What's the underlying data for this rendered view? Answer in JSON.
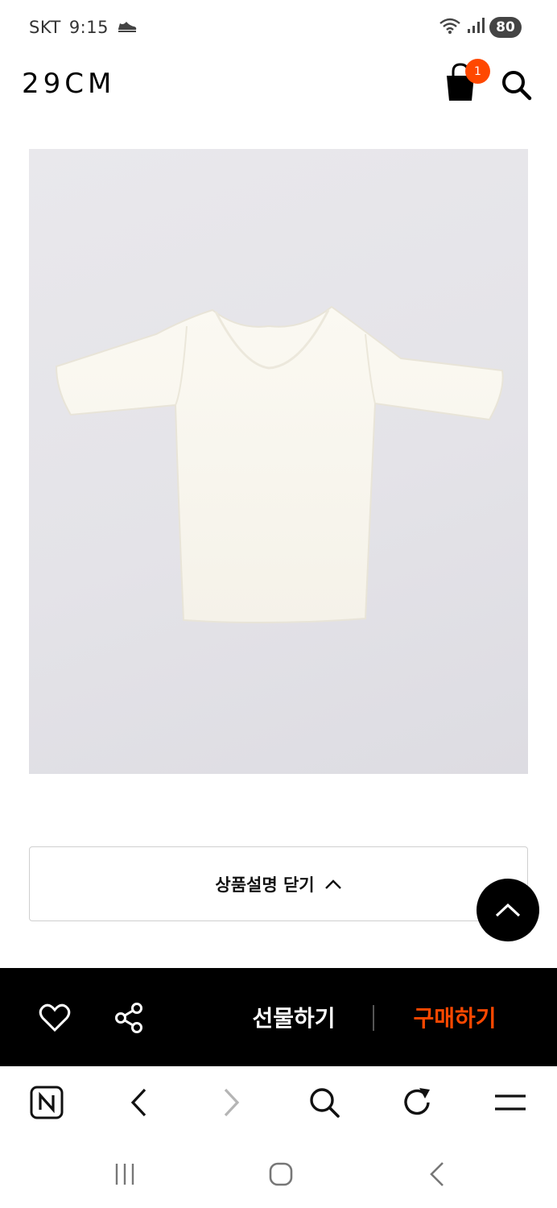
{
  "status_bar": {
    "carrier": "SKT",
    "time": "9:15",
    "battery": "80"
  },
  "header": {
    "logo": "29CM",
    "cart_count": "1"
  },
  "product": {
    "image_alt": "white lettuce-trim ribbed half-sleeve top"
  },
  "description_toggle": {
    "label": "상품설명 닫기"
  },
  "purchase_bar": {
    "gift_label": "선물하기",
    "buy_label": "구매하기",
    "buy_color": "#ff4800"
  },
  "browser_toolbar": {
    "items": [
      "naver-icon",
      "back-icon",
      "forward-icon",
      "search-icon",
      "refresh-icon",
      "menu-icon"
    ]
  },
  "android_nav": {
    "items": [
      "recent-apps-icon",
      "home-icon",
      "back-icon"
    ]
  },
  "colors": {
    "accent": "#ff4800",
    "bar_background": "#000000"
  }
}
